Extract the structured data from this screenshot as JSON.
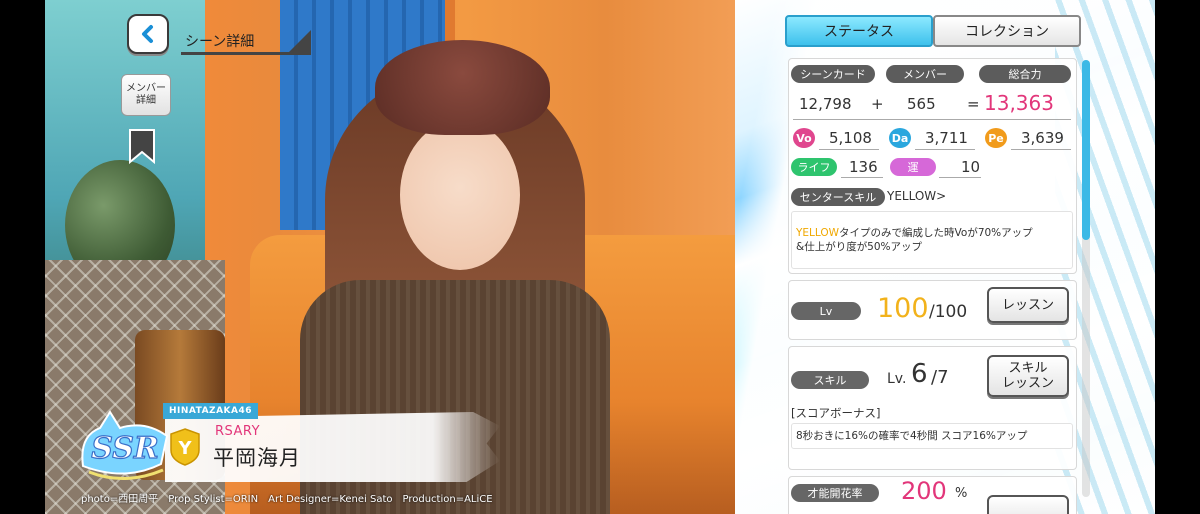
{
  "header": {
    "back_icon": "chevron-left-icon",
    "scene_title": "シーン詳細",
    "member_button": "メンバー詳細",
    "bookmark_icon": "bookmark-icon"
  },
  "tabs": [
    {
      "label": "ステータス",
      "active": true
    },
    {
      "label": "コレクション",
      "active": false
    }
  ],
  "stats": {
    "scene_card_label": "シーンカード",
    "member_label": "メンバー",
    "total_label": "総合力",
    "scene_card_value": "12,798",
    "plus": "+",
    "member_value": "565",
    "equals": "=",
    "total_value": "13,363",
    "vo_label": "Vo",
    "vo_value": "5,108",
    "da_label": "Da",
    "da_value": "3,711",
    "pe_label": "Pe",
    "pe_value": "3,639",
    "life_label": "ライフ",
    "life_value": "136",
    "luck_label": "運",
    "luck_value": "10",
    "center_skill_label": "センタースキル",
    "center_skill_name": "YELLOW>",
    "center_skill_desc_highlight": "YELLOW",
    "center_skill_desc_line1": "タイプのみで編成した時Voが70%アップ",
    "center_skill_desc_line2": "&仕上がり度が50%アップ"
  },
  "level": {
    "label": "Lv",
    "current": "100",
    "max": "/100",
    "lesson_button": "レッスン"
  },
  "skill": {
    "label": "スキル",
    "lv_prefix": "Lv.",
    "current": "6",
    "max": "/7",
    "lesson_button_line1": "スキル",
    "lesson_button_line2": "レッスン",
    "type": "[スコアボーナス]",
    "desc": "8秒おきに16%の確率で4秒間 スコア16%アップ"
  },
  "bloom": {
    "label": "才能開花率",
    "value": "200",
    "unit": "%"
  },
  "card": {
    "group_tag": "HINATAZAKA46",
    "rarity": "SSR",
    "type_badge": "Y",
    "title_fragment": "RSARY",
    "member_name": "平岡海月"
  },
  "credits": "photo=西田周平　Prop Stylist=ORIN　Art Designer=Kenei Sato　Production=ALiCE",
  "colors": {
    "accent_tab": "#3ec1ec",
    "total_pink": "#e2367a",
    "level_gold": "#f2b21b",
    "vo": "#e0468e",
    "da": "#2aa7de",
    "pe": "#f19b1b",
    "life": "#2ec46e",
    "luck": "#d668d8",
    "yellow_type": "#f0c01a"
  }
}
